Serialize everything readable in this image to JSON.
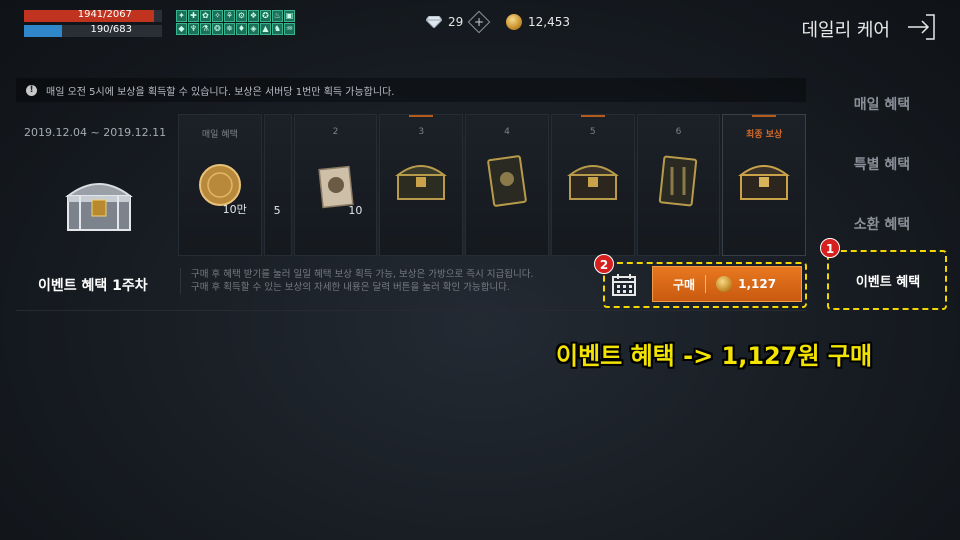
{
  "hud": {
    "hp_text": "1941/2067",
    "hp_ratio": 0.939,
    "mp_text": "190/683",
    "mp_ratio": 0.278,
    "buffs": [
      "✦",
      "✚",
      "✿",
      "✧",
      "⚘",
      "⚙",
      "❖",
      "✪",
      "♨",
      "▣",
      "◆",
      "♆",
      "⚗",
      "❂",
      "✵",
      "♦",
      "◈",
      "▲",
      "♞",
      "♒"
    ]
  },
  "currency": {
    "gems": "29",
    "gold": "12,453"
  },
  "header": {
    "title": "데일리 케어"
  },
  "notice": {
    "icon": "!",
    "text": "매일 오전 5시에 보상을 획득할 수 있습니다. 보상은 서버당 1번만 획득 가능합니다."
  },
  "sidebar": {
    "items": [
      {
        "label": "매일 혜택"
      },
      {
        "label": "특별 혜택"
      },
      {
        "label": "소환 혜택"
      }
    ]
  },
  "event": {
    "date_range": "2019.12.04 ~ 2019.12.11",
    "title": "이벤트 혜택 1주차",
    "description_1": "구매 후 혜택 받기를 눌러 일일 혜택 보상 획득 가능, 보상은 가방으로 즉시 지급됩니다.",
    "description_2": "구매 후 획득할 수 있는 보상의 자세한 내용은 달력 버튼을 눌러 확인 가능합니다."
  },
  "rewards": {
    "slot0_label": "매일 혜택",
    "slot0_qty": "10만",
    "slot1_label": "",
    "slot1_qty": "5",
    "slot2_label": "2",
    "slot2_qty": "10",
    "slot3_label": "3",
    "slot4_label": "4",
    "slot5_label": "5",
    "slot6_label": "6",
    "final_label": "최종 보상"
  },
  "purchase": {
    "buy_label": "구매",
    "price": "1,127",
    "event_button_label": "이벤트 혜택"
  },
  "annotations": {
    "badge1": "1",
    "badge2": "2",
    "caption": "이벤트 혜택 -> 1,127원 구매",
    "highlight_color": "#f4d600",
    "badge_color": "#d61f1f"
  },
  "colors": {
    "accent_orange": "#e8781f",
    "hp_red": "#c0341f",
    "mp_blue": "#2f86c8"
  }
}
